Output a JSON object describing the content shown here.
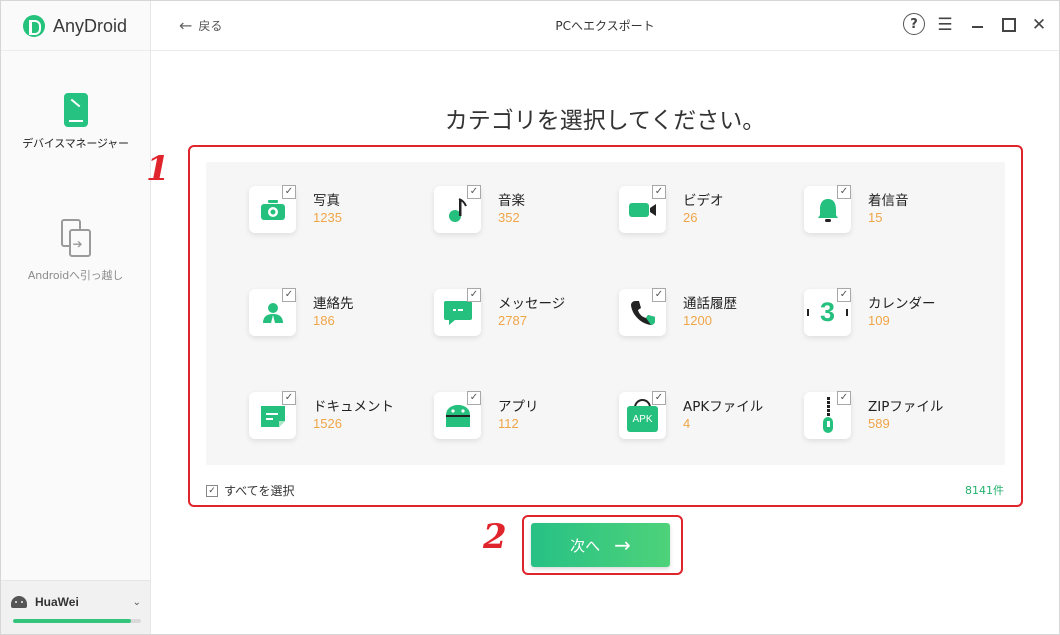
{
  "app": {
    "name": "AnyDroid"
  },
  "sidebar": {
    "items": [
      {
        "label": "デバイスマネージャー",
        "active": true
      },
      {
        "label": "Androidへ引っ越し",
        "active": false
      }
    ],
    "device": {
      "name": "HuaWei",
      "storage_used_fraction": 0.92
    }
  },
  "header": {
    "back_label": "戻る",
    "title": "PCへエクスポート",
    "help_glyph": "?",
    "menu_glyph": "☰",
    "close_glyph": "✕"
  },
  "main": {
    "heading": "カテゴリを選択してください。",
    "categories": [
      {
        "name": "写真",
        "count": "1235",
        "icon": "photo-icon",
        "checked": true
      },
      {
        "name": "音楽",
        "count": "352",
        "icon": "music-icon",
        "checked": true
      },
      {
        "name": "ビデオ",
        "count": "26",
        "icon": "video-icon",
        "checked": true
      },
      {
        "name": "着信音",
        "count": "15",
        "icon": "ringtone-icon",
        "checked": true
      },
      {
        "name": "連絡先",
        "count": "186",
        "icon": "contacts-icon",
        "checked": true
      },
      {
        "name": "メッセージ",
        "count": "2787",
        "icon": "messages-icon",
        "checked": true
      },
      {
        "name": "通話履歴",
        "count": "1200",
        "icon": "call-log-icon",
        "checked": true
      },
      {
        "name": "カレンダー",
        "count": "109",
        "icon": "calendar-icon",
        "checked": true
      },
      {
        "name": "ドキュメント",
        "count": "1526",
        "icon": "document-icon",
        "checked": true
      },
      {
        "name": "アプリ",
        "count": "112",
        "icon": "android-app-icon",
        "checked": true
      },
      {
        "name": "APKファイル",
        "count": "4",
        "icon": "apk-icon",
        "checked": true
      },
      {
        "name": "ZIPファイル",
        "count": "589",
        "icon": "zip-icon",
        "checked": true
      }
    ],
    "calendar_glyph": "3",
    "apk_glyph": "APK",
    "check_glyph": "✓",
    "select_all_label": "すべてを選択",
    "total_label": "8141件",
    "next_label": "次へ",
    "next_arrow": "→"
  },
  "annotations": {
    "step1": "1",
    "step2": "2"
  },
  "colors": {
    "accent": "#25c07d",
    "count": "#f0a548",
    "highlight": "#e0242c"
  }
}
